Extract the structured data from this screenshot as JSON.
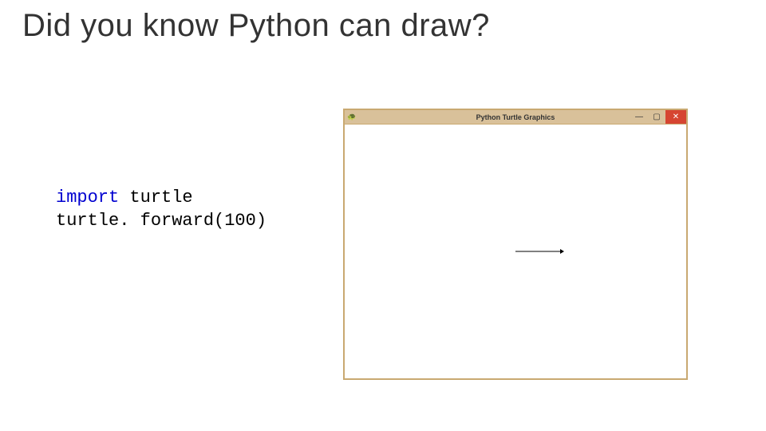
{
  "slide": {
    "title": "Did you know Python can draw?"
  },
  "code": {
    "line1_kw": "import",
    "line1_mod": " turtle",
    "line2": "turtle. forward(100)"
  },
  "window": {
    "icon": "🐢",
    "title": "Python Turtle Graphics",
    "controls": {
      "minimize": "—",
      "maximize": "▢",
      "close": "✕"
    }
  }
}
